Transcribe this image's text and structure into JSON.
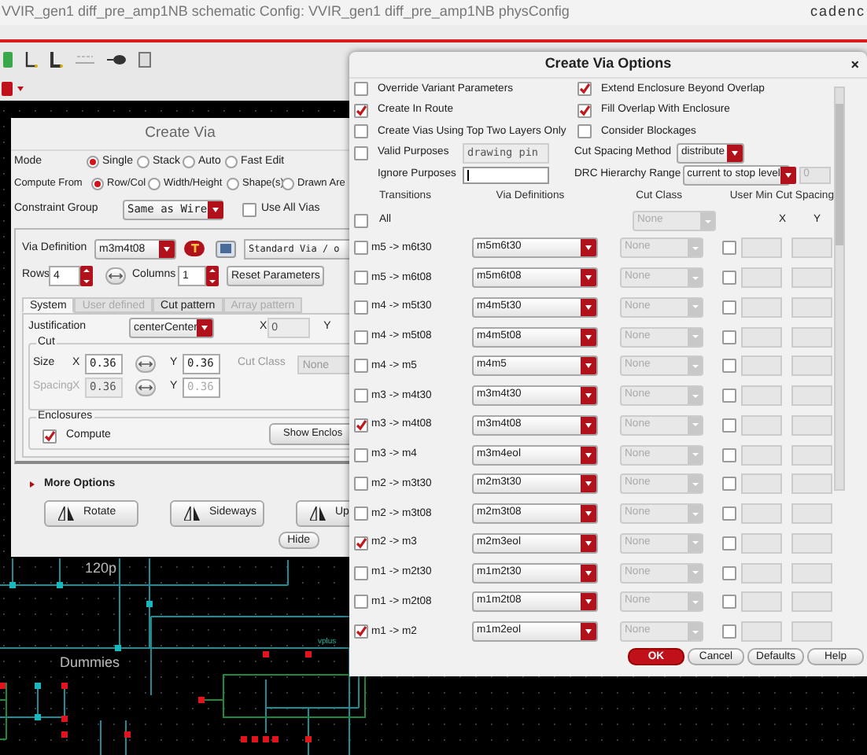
{
  "main_window": {
    "title": "VVIR_gen1 diff_pre_amp1NB schematic  Config: VVIR_gen1 diff_pre_amp1NB physConfig",
    "logo": "cadenc"
  },
  "schematic": {
    "labels": [
      "120p",
      "Dummies",
      "vplus"
    ]
  },
  "create_via": {
    "title": "Create Via",
    "mode": {
      "label": "Mode",
      "options": [
        {
          "label": "Single",
          "selected": true
        },
        {
          "label": "Stack",
          "selected": false
        },
        {
          "label": "Auto",
          "selected": false
        },
        {
          "label": "Fast Edit",
          "selected": false
        }
      ]
    },
    "compute_from": {
      "label": "Compute From",
      "options": [
        {
          "label": "Row/Col",
          "selected": true
        },
        {
          "label": "Width/Height",
          "selected": false
        },
        {
          "label": "Shape(s)",
          "selected": false
        },
        {
          "label": "Drawn Are",
          "selected": false
        }
      ]
    },
    "constraint_group": {
      "label": "Constraint Group",
      "value": "Same as Wire"
    },
    "use_all_vias": {
      "label": "Use All Vias",
      "checked": false
    },
    "via_definition": {
      "label": "Via Definition",
      "value": "m3m4t08",
      "standard": "Standard Via / o"
    },
    "rows": {
      "label": "Rows",
      "value": "4"
    },
    "columns": {
      "label": "Columns",
      "value": "1"
    },
    "reset_button": "Reset Parameters",
    "tabs": [
      {
        "label": "System",
        "selected": true,
        "disabled": false
      },
      {
        "label": "User defined",
        "selected": false,
        "disabled": true
      },
      {
        "label": "Cut pattern",
        "selected": false,
        "disabled": false
      },
      {
        "label": "Array pattern",
        "selected": false,
        "disabled": true
      }
    ],
    "justification": {
      "label": "Justification",
      "value": "centerCenter",
      "x_label": "X",
      "x_value": "0",
      "y_label": "Y"
    },
    "cut": {
      "legend": "Cut",
      "cut_class_label": "Cut Class",
      "cut_class_value": "None",
      "rows": [
        {
          "label": "Size",
          "disabled": false,
          "x_label": "X",
          "x_value": "0.36",
          "y_label": "Y",
          "y_value": "0.36"
        },
        {
          "label": "Spacing",
          "disabled": true,
          "x_label": "X",
          "x_value": "0.36",
          "y_label": "Y",
          "y_value": "0.36"
        }
      ]
    },
    "enclosures": {
      "legend": "Enclosures",
      "compute": {
        "label": "Compute",
        "checked": true
      },
      "show_button": "Show Enclos"
    },
    "more_options": "More Options",
    "buttons": [
      "Rotate",
      "Sideways",
      "Up"
    ],
    "hide": "Hide"
  },
  "options": {
    "title": "Create Via Options",
    "close": "×",
    "left_checks": [
      {
        "label": "Override Variant Parameters",
        "checked": false
      },
      {
        "label": "Create In Route",
        "checked": true
      },
      {
        "label": "Create Vias Using Top Two Layers Only",
        "checked": false
      }
    ],
    "right_checks": [
      {
        "label": "Extend Enclosure Beyond Overlap",
        "checked": true
      },
      {
        "label": "Fill Overlap With Enclosure",
        "checked": true
      },
      {
        "label": "Consider Blockages",
        "checked": false
      }
    ],
    "valid_purposes": {
      "label": "Valid Purposes",
      "checked": false,
      "value": "drawing pin"
    },
    "ignore_purposes": {
      "label": "Ignore Purposes"
    },
    "cut_spacing_method": {
      "label": "Cut Spacing Method",
      "value": "distribute"
    },
    "drc_hierarchy_range": {
      "label": "DRC Hierarchy Range",
      "value": "current to stop level",
      "spin": "0"
    },
    "headers": {
      "transitions": "Transitions",
      "via_definitions": "Via Definitions",
      "cut_class": "Cut Class",
      "user_min": "User Min Cut Spacing",
      "x": "X",
      "y": "Y"
    },
    "all": {
      "label": "All",
      "checked": false,
      "cut_class": "None"
    },
    "transitions": [
      {
        "label": "m5 -> m6t30",
        "checked": false,
        "via": "m5m6t30",
        "cut_class": "None",
        "user_min": false
      },
      {
        "label": "m5 -> m6t08",
        "checked": false,
        "via": "m5m6t08",
        "cut_class": "None",
        "user_min": false
      },
      {
        "label": "m4 -> m5t30",
        "checked": false,
        "via": "m4m5t30",
        "cut_class": "None",
        "user_min": false
      },
      {
        "label": "m4 -> m5t08",
        "checked": false,
        "via": "m4m5t08",
        "cut_class": "None",
        "user_min": false
      },
      {
        "label": "m4 -> m5",
        "checked": false,
        "via": "m4m5",
        "cut_class": "None",
        "user_min": false
      },
      {
        "label": "m3 -> m4t30",
        "checked": false,
        "via": "m3m4t30",
        "cut_class": "None",
        "user_min": false
      },
      {
        "label": "m3 -> m4t08",
        "checked": true,
        "via": "m3m4t08",
        "cut_class": "None",
        "user_min": false
      },
      {
        "label": "m3 -> m4",
        "checked": false,
        "via": "m3m4eol",
        "cut_class": "None",
        "user_min": false
      },
      {
        "label": "m2 -> m3t30",
        "checked": false,
        "via": "m2m3t30",
        "cut_class": "None",
        "user_min": false
      },
      {
        "label": "m2 -> m3t08",
        "checked": false,
        "via": "m2m3t08",
        "cut_class": "None",
        "user_min": false
      },
      {
        "label": "m2 -> m3",
        "checked": true,
        "via": "m2m3eol",
        "cut_class": "None",
        "user_min": false
      },
      {
        "label": "m1 -> m2t30",
        "checked": false,
        "via": "m1m2t30",
        "cut_class": "None",
        "user_min": false
      },
      {
        "label": "m1 -> m2t08",
        "checked": false,
        "via": "m1m2t08",
        "cut_class": "None",
        "user_min": false
      },
      {
        "label": "m1 -> m2",
        "checked": true,
        "via": "m1m2eol",
        "cut_class": "None",
        "user_min": false
      }
    ],
    "buttons": [
      {
        "label": "OK",
        "kind": "primary"
      },
      {
        "label": "Cancel",
        "kind": "normal"
      },
      {
        "label": "Defaults",
        "kind": "normal"
      },
      {
        "label": "Help",
        "kind": "normal"
      }
    ]
  }
}
